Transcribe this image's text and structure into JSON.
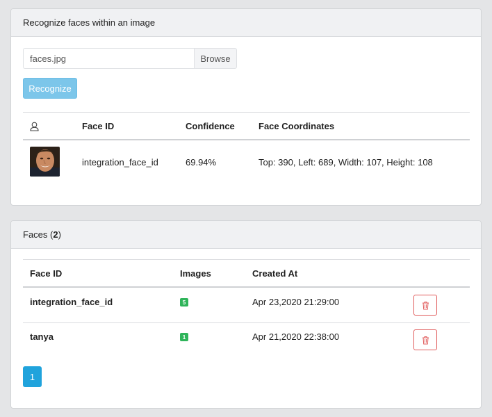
{
  "recognize_card": {
    "title": "Recognize faces within an image",
    "file_value": "faces.jpg",
    "browse_label": "Browse",
    "recognize_label": "Recognize",
    "table": {
      "headers": {
        "icon": "user-icon",
        "face_id": "Face ID",
        "confidence": "Confidence",
        "coordinates": "Face Coordinates"
      },
      "rows": [
        {
          "face_id": "integration_face_id",
          "confidence": "69.94%",
          "coordinates": "Top: 390, Left: 689, Width: 107, Height: 108"
        }
      ]
    }
  },
  "faces_card": {
    "title_prefix": "Faces (",
    "count": "2",
    "title_suffix": ")",
    "table": {
      "headers": {
        "face_id": "Face ID",
        "images": "Images",
        "created_at": "Created At"
      },
      "rows": [
        {
          "face_id": "integration_face_id",
          "images": "5",
          "created_at": "Apr 23,2020 21:29:00",
          "action_icon": "trash-icon"
        },
        {
          "face_id": "tanya",
          "images": "1",
          "created_at": "Apr 21,2020 22:38:00",
          "action_icon": "trash-icon"
        }
      ]
    },
    "pagination": {
      "current_page": "1"
    }
  },
  "colors": {
    "primary": "#20a3dc",
    "primary_disabled": "#7cc6ea",
    "success_badge": "#2fb45a",
    "danger": "#e05a5a"
  }
}
